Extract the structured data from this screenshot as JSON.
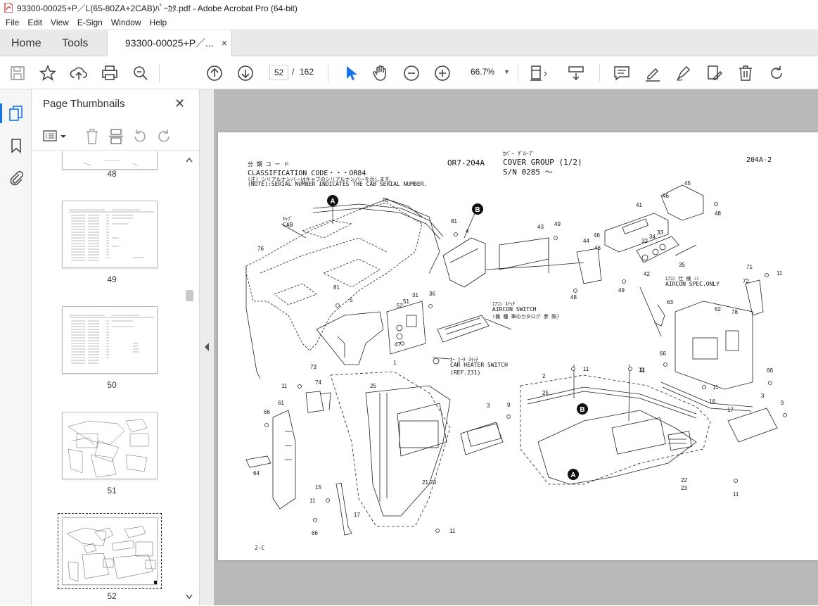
{
  "window": {
    "title": "93300-00025+P／L(65-80ZA+2CAB)ﾊﾟｰｶﾀ.pdf - Adobe Acrobat Pro (64-bit)"
  },
  "menu": [
    "File",
    "Edit",
    "View",
    "E-Sign",
    "Window",
    "Help"
  ],
  "tabs": {
    "home": "Home",
    "tools": "Tools",
    "document": "93300-00025+P／...",
    "close": "×"
  },
  "toolbar": {
    "current_page": "52",
    "page_separator": "/",
    "total_pages": "162",
    "zoom": "66.7%"
  },
  "thumbnail_panel": {
    "title": "Page Thumbnails",
    "close": "✕",
    "pages": [
      "48",
      "49",
      "50",
      "51",
      "52"
    ],
    "selected_page": "52"
  },
  "document_page": {
    "classification_jp": "分 類 コ ー ド",
    "classification": "CLASSIFICATION CODE・・・OR84",
    "note_jp": "(注) シリアルナンバーはキャブのシリアルナンバーを示します。",
    "note": "(NOTE):SERIAL NUMBER INDICATES THE CAB SERIAL NUMBER.",
    "code": "OR7-204A",
    "group_jp": "ｶﾊﾞｰ ｸﾞﾙｰﾌﾟ",
    "group": "COVER GROUP (1/2)",
    "serial": "S/N 0285 ～",
    "page_ref": "204A-2",
    "cab_jp": "ｷｬﾌﾞ",
    "cab": "CAB",
    "aircon_switch_jp": "ｴｱｺﾝ ｽｲｯﾁ",
    "aircon_switch": "AIRCON SWITCH",
    "aircon_switch_note": "(機 種 車のカタログ 参 照)",
    "car_heater_jp": "ｶｰ ﾋｰﾀ ｽｲｯﾁ",
    "car_heater": "CAR HEATER SWITCH",
    "ref": "(REF.231)",
    "aircon_spec_jp": "ｴｱｺﾝ 仕 様 ﾉﾐ",
    "aircon_spec": "AIRCON SPEC.ONLY",
    "footer": "2-C",
    "callouts": [
      "A",
      "B"
    ],
    "part_numbers": [
      "76",
      "76",
      "81",
      "4",
      "43",
      "49",
      "46",
      "41",
      "45",
      "46",
      "48",
      "44",
      "46",
      "32",
      "34",
      "33",
      "42",
      "35",
      "49",
      "48",
      "81",
      "5",
      "52",
      "51",
      "31",
      "36",
      "47",
      "63",
      "62",
      "78",
      "71",
      "72",
      "11",
      "66",
      "66",
      "11",
      "11",
      "1",
      "73",
      "74",
      "11",
      "61",
      "66",
      "64",
      "25",
      "3",
      "9",
      "2",
      "25",
      "15",
      "11",
      "17",
      "66",
      "21,23",
      "11",
      "11",
      "11",
      "16",
      "17",
      "3",
      "9",
      "22",
      "23",
      "11"
    ]
  }
}
